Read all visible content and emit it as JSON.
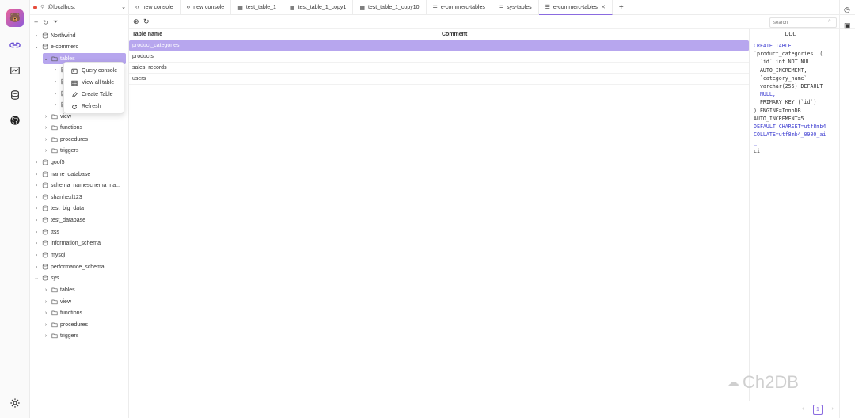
{
  "connection": {
    "name": "@localhost"
  },
  "tree": {
    "northwind": "Northwind",
    "ecommerc": "e-commerc",
    "tables": "tables",
    "view": "view",
    "functions": "functions",
    "procedures": "procedures",
    "triggers": "triggers",
    "dbs": [
      "goof5",
      "name_database",
      "schema_nameschema_na...",
      "shanhexl123",
      "test_big_data",
      "test_database",
      "ttss",
      "information_schema",
      "mysql",
      "performance_schema",
      "sys"
    ],
    "sys_children": [
      "tables",
      "view",
      "functions",
      "procedures",
      "triggers"
    ]
  },
  "context_menu": [
    "Query console",
    "View all table",
    "Create Table",
    "Refresh"
  ],
  "tabs": [
    "new console",
    "new console",
    "test_table_1",
    "test_table_1_copy1",
    "test_table_1_copy10",
    "e-commerc-tables",
    "sys-tables",
    "e-commerc-tables"
  ],
  "search": {
    "placeholder": "search"
  },
  "grid": {
    "headers": [
      "Table name",
      "Comment"
    ],
    "rows": [
      "product_categories",
      "products",
      "sales_records",
      "users"
    ]
  },
  "ddl": {
    "title": "DDL",
    "lines": [
      "CREATE TABLE",
      "`product_categories` (",
      "  `id` int NOT NULL",
      "  AUTO_INCREMENT,",
      "  `category_name`",
      "  varchar(255) DEFAULT",
      "  NULL,",
      "  PRIMARY KEY (`id`)",
      ") ENGINE=InnoDB",
      "AUTO_INCREMENT=5",
      "DEFAULT CHARSET=utf8mb4",
      "COLLATE=utf8mb4_0900_ai_",
      "ci"
    ]
  },
  "pager": {
    "current": "1"
  },
  "watermark": "Ch2DB"
}
